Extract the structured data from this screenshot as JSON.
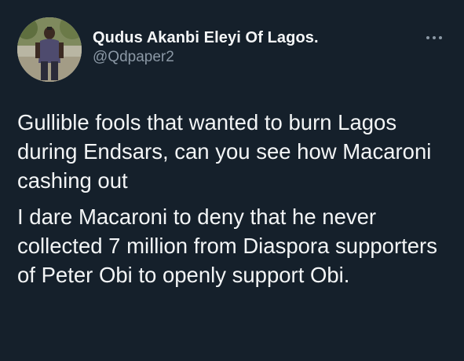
{
  "tweet": {
    "author": {
      "display_name": "Qudus Akanbi Eleyi Of Lagos.",
      "handle": "@Qdpaper2",
      "avatar_icon": "profile-photo"
    },
    "more_icon": "more-horizontal-icon",
    "paragraphs": [
      "Gullible fools that wanted to burn Lagos during Endsars, can you see how Macaroni cashing out",
      "I dare Macaroni to deny that he never collected 7 million from Diaspora supporters of Peter Obi to openly support Obi."
    ]
  },
  "colors": {
    "background": "#15202b",
    "text": "#e7e9ea",
    "secondary_text": "#8b98a5"
  }
}
